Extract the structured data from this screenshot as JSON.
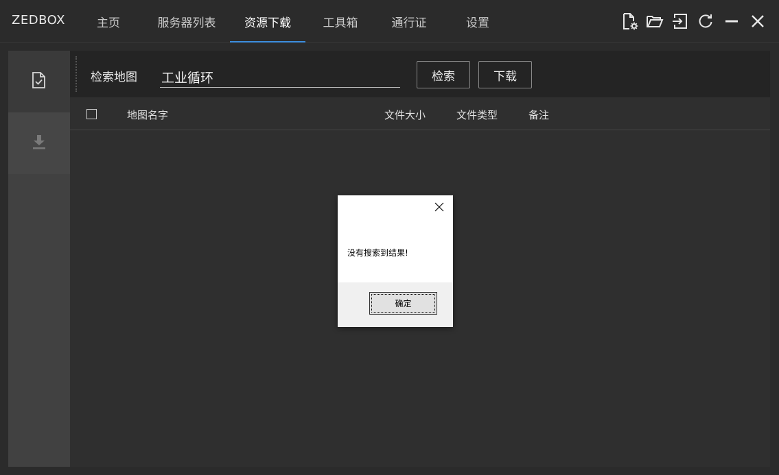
{
  "app": {
    "brand": "ZEDBOX"
  },
  "nav": {
    "tabs": [
      {
        "label": "主页"
      },
      {
        "label": "服务器列表"
      },
      {
        "label": "资源下载",
        "active": true
      },
      {
        "label": "工具箱"
      },
      {
        "label": "通行证"
      },
      {
        "label": "设置"
      }
    ]
  },
  "toolbar_icons": [
    "file-settings-icon",
    "folder-open-icon",
    "sign-in-icon",
    "refresh-icon",
    "minimize-icon",
    "close-icon"
  ],
  "sidebar": {
    "items": [
      {
        "icon": "file-check-icon",
        "active": true
      },
      {
        "icon": "download-icon",
        "active": false
      }
    ]
  },
  "search": {
    "label": "检索地图",
    "value": "工业循环",
    "search_button": "检索",
    "download_button": "下载"
  },
  "table": {
    "columns": [
      "地图名字",
      "文件大小",
      "文件类型",
      "备注"
    ],
    "rows": []
  },
  "dialog": {
    "message": "没有搜索到结果!",
    "ok_label": "确定"
  },
  "colors": {
    "accent": "#3d8fe0",
    "background": "#2b2b2b",
    "panel": "#2f2f2f"
  }
}
